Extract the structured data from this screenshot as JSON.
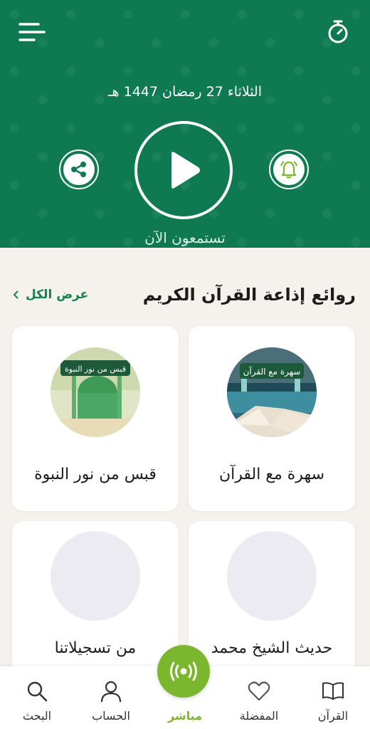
{
  "header": {
    "date": "الثلاثاء 27 رمضان 1447 هـ",
    "listening_label": "تستمعون الآن"
  },
  "section": {
    "title": "روائع إذاعة القرآن الكريم",
    "view_all": "عرض الكل"
  },
  "cards": [
    {
      "title": "سهرة مع القرآن",
      "image_text": "سهرة مع القرآن"
    },
    {
      "title": "قبس من نور النبوة",
      "image_text": "قبس من نور النبوة"
    },
    {
      "title": "حديث الشيخ محمد"
    },
    {
      "title": "من تسجيلاتنا"
    }
  ],
  "tabbar": {
    "items": [
      {
        "label": "القرآن",
        "icon": "book-icon"
      },
      {
        "label": "المفضلة",
        "icon": "heart-icon"
      },
      {
        "label": "مباشر",
        "icon": "live-broadcast-icon",
        "active": true
      },
      {
        "label": "الحساب",
        "icon": "user-icon"
      },
      {
        "label": "البحث",
        "icon": "search-icon"
      }
    ]
  },
  "colors": {
    "header_green": "#0f7a52",
    "accent_green": "#7ab72f",
    "link_green": "#13824f",
    "background": "#f5f1ec"
  }
}
